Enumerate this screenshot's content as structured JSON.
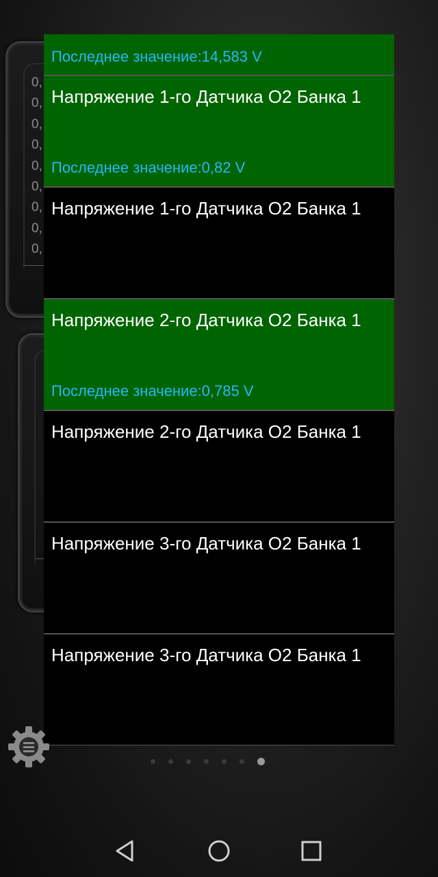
{
  "background_gauge": {
    "axis_values": [
      "0,",
      "0,",
      "0,",
      "0,",
      "0,",
      "0,",
      "0,",
      "0,",
      "0,"
    ]
  },
  "sensor_list": {
    "items": [
      {
        "title": "",
        "value": "Последнее значение:14,583 V",
        "selected": true
      },
      {
        "title": "Напряжение 1-го Датчика O2 Банка 1",
        "value": "Последнее значение:0,82 V",
        "selected": true
      },
      {
        "title": "Напряжение 1-го Датчика O2 Банка 1",
        "value": "",
        "selected": false
      },
      {
        "title": "Напряжение 2-го Датчика O2 Банка 1",
        "value": "Последнее значение:0,785 V",
        "selected": true
      },
      {
        "title": "Напряжение 2-го Датчика O2 Банка 1",
        "value": "",
        "selected": false
      },
      {
        "title": "Напряжение 3-го Датчика O2 Банка 1",
        "value": "",
        "selected": false
      },
      {
        "title": "Напряжение 3-го Датчика O2 Банка 1",
        "value": "",
        "selected": false
      }
    ]
  },
  "page_indicator": {
    "total": 7,
    "active": 7
  },
  "colors": {
    "selected_bg": "#006400",
    "value_text": "#29b6f6",
    "title_text": "#ffffff",
    "list_bg": "#000000"
  },
  "icons": {
    "settings": "gear-icon",
    "nav_back": "back-triangle-icon",
    "nav_home": "home-circle-icon",
    "nav_recents": "recents-square-icon"
  }
}
